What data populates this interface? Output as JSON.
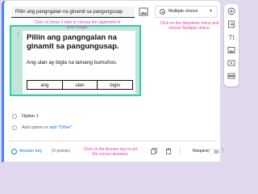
{
  "question": {
    "title": "Piliin ang pangngalan na ginamit sa pangungusap.",
    "type_label": "Multiple choice"
  },
  "image": {
    "title": "Piliin ang pangngalan na ginamit sa pangungusap.",
    "sentence": "Ang ulan ay bigla na lamang bumuhos.",
    "choices": [
      "ang",
      "ulan",
      "biglo"
    ]
  },
  "hints": {
    "dropdown": "Click on the dropdown menu and choose Multiple choice.",
    "dots": "Click on these 3 dots to choose the alignment of your image.",
    "answer_key": "Click on the Answer key to set the correct answers."
  },
  "options": [
    {
      "label": "Option 1"
    }
  ],
  "add_option": {
    "add_label": "Add option",
    "or_label": "or",
    "other_label": "add \"Other\""
  },
  "footer": {
    "answer_key_label": "Answer key",
    "points_label": "(0 points)",
    "required_label": "Required",
    "required_on": false
  },
  "colors": {
    "accent": "#4285f4",
    "link": "#1a73e8",
    "hint": "#e040a8",
    "image_border": "#36c9b0",
    "image_bg": "#bfe6d8",
    "page_bg": "#e2d9ef"
  },
  "icons": {
    "question_image": "image-icon",
    "type_select": "radio-button-icon",
    "drag": "drag-dots-icon",
    "answer_key": "check-circle-icon",
    "duplicate": "copy-icon",
    "delete": "trash-icon",
    "more": "more-vert-icon",
    "side": [
      "add-circle-icon",
      "import-icon",
      "title-icon",
      "image-icon",
      "video-icon",
      "section-icon"
    ]
  }
}
